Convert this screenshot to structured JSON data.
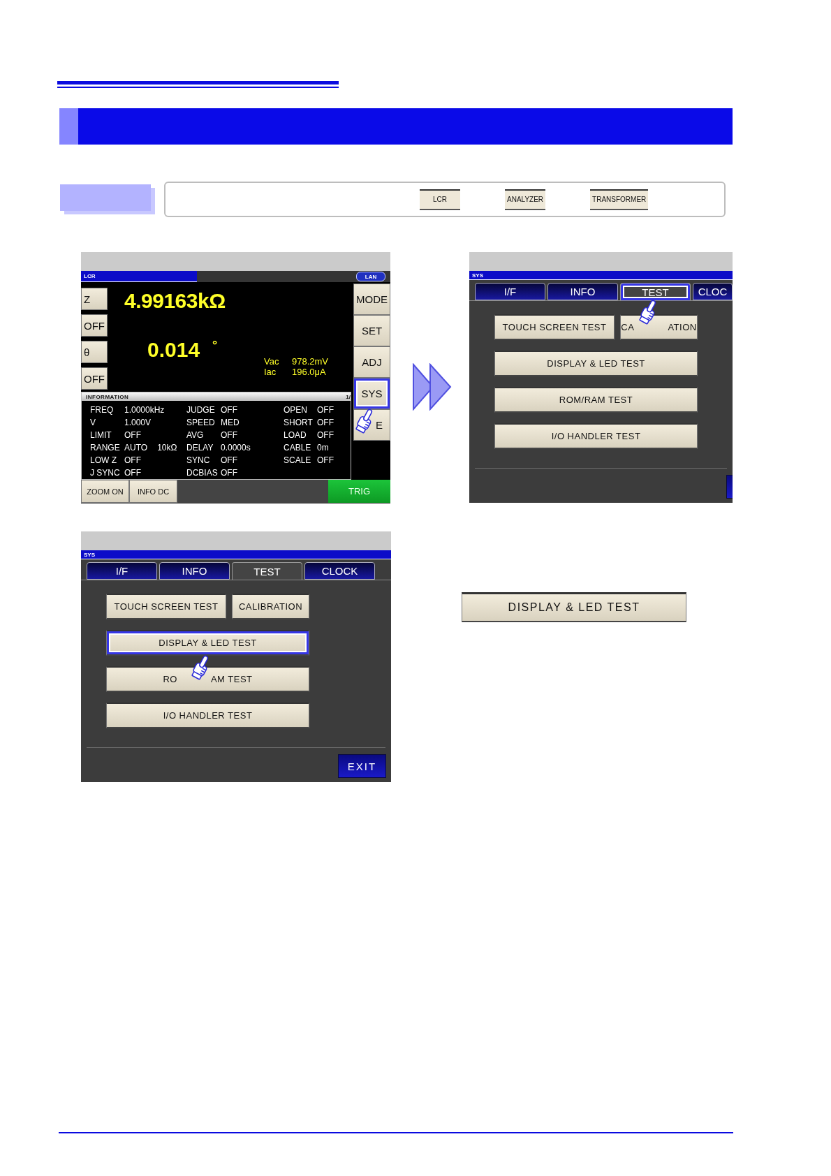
{
  "mode_selector": {
    "buttons": [
      {
        "label": "LCR"
      },
      {
        "label": "ANALYZER"
      },
      {
        "label": "TRANSFORMER"
      }
    ]
  },
  "screens": [
    {
      "kind": "measurement",
      "title": "LCR",
      "status": "LAN",
      "parameter_keys": [
        "Z",
        "OFF",
        "θ",
        "OFF"
      ],
      "primary_reading": "4.99163kΩ",
      "secondary_reading": {
        "value": "0.014",
        "unit": "°"
      },
      "monitor": [
        {
          "label": "Vac",
          "value": "978.2mV"
        },
        {
          "label": "Iac",
          "value": "196.0μA"
        }
      ],
      "side_buttons": [
        {
          "label": "MODE",
          "highlighted": false
        },
        {
          "label": "SET",
          "highlighted": false
        },
        {
          "label": "ADJ",
          "highlighted": false
        },
        {
          "label": "SYS",
          "highlighted": true
        },
        {
          "label": "E",
          "highlighted": false,
          "covered": true
        }
      ],
      "information": {
        "title": "INFORMATION",
        "page": "1/",
        "rows": [
          {
            "cells": [
              "FREQ",
              "1.0000kHz",
              "JUDGE",
              "OFF",
              "OPEN",
              "OFF"
            ]
          },
          {
            "cells": [
              "V",
              "1.000V",
              "SPEED",
              "MED",
              "SHORT",
              "OFF"
            ]
          },
          {
            "cells": [
              "LIMIT",
              "OFF",
              "AVG",
              "OFF",
              "LOAD",
              "OFF"
            ]
          },
          {
            "cells": [
              "RANGE",
              "AUTO",
              "DELAY",
              "0.0000s",
              "CABLE",
              "0m"
            ],
            "extra": "10kΩ"
          },
          {
            "cells": [
              "LOW Z",
              "OFF",
              "SYNC",
              "OFF",
              "SCALE",
              "OFF"
            ]
          },
          {
            "cells": [
              "J SYNC",
              "OFF",
              "DCBIAS",
              "OFF"
            ]
          }
        ]
      },
      "bottom_buttons": [
        {
          "label": "ZOOM ON"
        },
        {
          "label": "INFO DC"
        }
      ],
      "trigger_button": {
        "label": "TRIG"
      }
    },
    {
      "kind": "system",
      "title": "SYS",
      "tabs": [
        {
          "label": "I/F",
          "selected": false,
          "highlighted": false
        },
        {
          "label": "INFO",
          "selected": false,
          "highlighted": false
        },
        {
          "label": "TEST",
          "selected": true,
          "highlighted": true
        },
        {
          "label": "CLOC",
          "selected": false,
          "highlighted": false
        }
      ],
      "buttons": [
        {
          "label": "TOUCH SCREEN TEST",
          "highlighted": false
        },
        {
          "label_parts": [
            "CA",
            "ATION"
          ],
          "highlighted": false
        },
        {
          "label": "DISPLAY & LED TEST",
          "highlighted": false
        },
        {
          "label": "ROM/RAM TEST",
          "highlighted": false
        },
        {
          "label": "I/O HANDLER TEST",
          "highlighted": false
        }
      ]
    },
    {
      "kind": "system",
      "title": "SYS",
      "tabs": [
        {
          "label": "I/F",
          "selected": false,
          "highlighted": false
        },
        {
          "label": "INFO",
          "selected": false,
          "highlighted": false
        },
        {
          "label": "TEST",
          "selected": true,
          "highlighted": false
        },
        {
          "label": "CLOCK",
          "selected": false,
          "highlighted": false
        }
      ],
      "buttons": [
        {
          "label": "TOUCH SCREEN TEST",
          "highlighted": false
        },
        {
          "label": "CALIBRATION",
          "highlighted": false
        },
        {
          "label": "DISPLAY & LED TEST",
          "highlighted": true
        },
        {
          "label_parts": [
            "RO",
            "AM TEST"
          ],
          "highlighted": false
        },
        {
          "label": "I/O HANDLER TEST",
          "highlighted": false
        }
      ],
      "exit_label": "EXIT"
    }
  ],
  "result_button": {
    "label": "DISPLAY & LED TEST"
  }
}
